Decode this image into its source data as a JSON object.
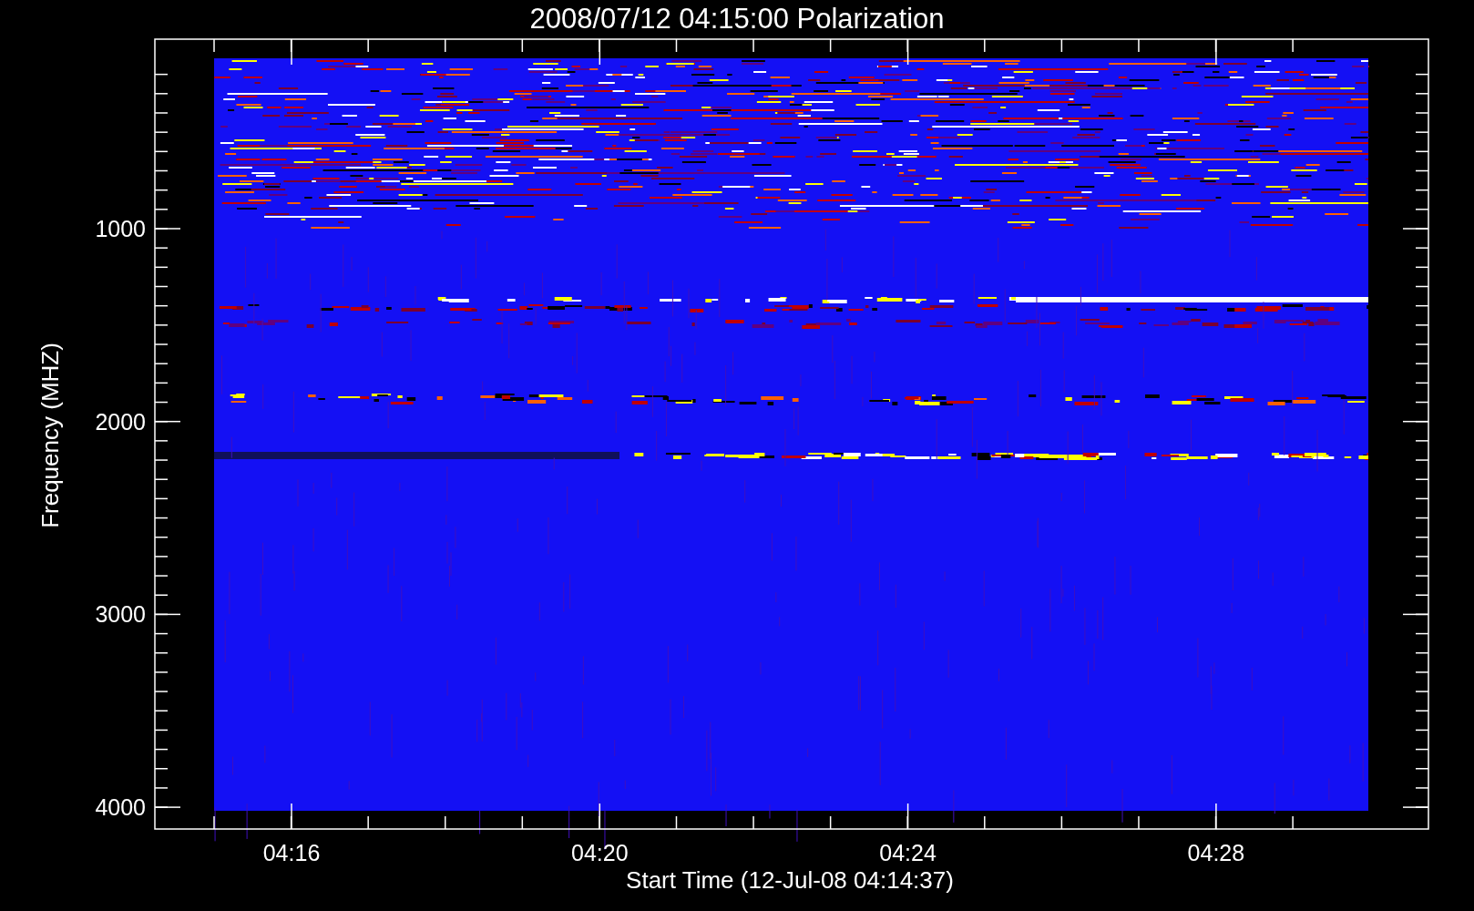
{
  "title": "2008/07/12 04:15:00 Polarization",
  "plot": {
    "xlabel": "Start Time (12-Jul-08 04:14:37)",
    "ylabel": "Frequency (MHZ)",
    "xticks": [
      "04:16",
      "04:20",
      "04:24",
      "04:28"
    ],
    "yticks": [
      "1000",
      "2000",
      "3000",
      "4000"
    ]
  }
}
